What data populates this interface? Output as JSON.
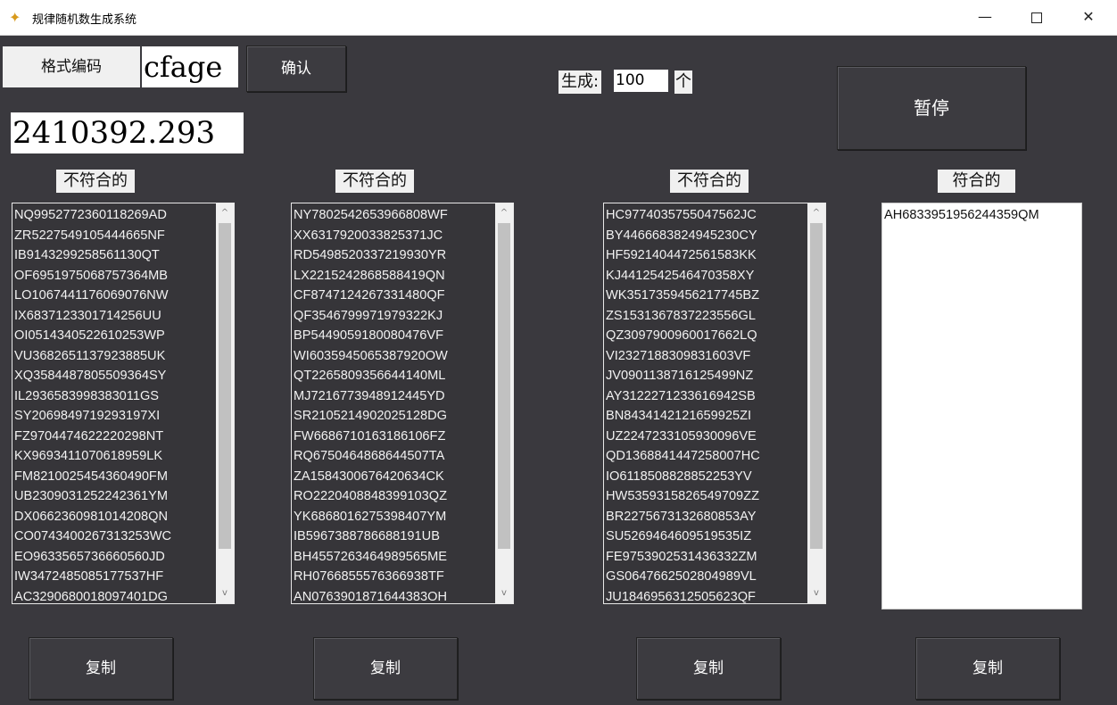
{
  "window": {
    "title": "规律随机数生成系统",
    "controls": {
      "minimize": "—",
      "close": "✕"
    }
  },
  "format": {
    "label": "格式编码",
    "value": "cfage",
    "confirm_label": "确认"
  },
  "generate": {
    "label": "生成:",
    "count": "100",
    "unit": "个",
    "pause_label": "暂停"
  },
  "number_display": "2410392.293",
  "columns": [
    {
      "label": "不符合的",
      "items": [
        "NQ9952772360118269AD",
        "ZR5227549105444665NF",
        "IB9143299258561130QT",
        "OF6951975068757364MB",
        "LO1067441176069076NW",
        "IX6837123301714256UU",
        "OI0514340522610253WP",
        "VU3682651137923885UK",
        "XQ3584487805509364SY",
        "IL2936583998383011GS",
        "SY2069849719293197XI",
        "FZ9704474622220298NT",
        "KX9693411070618959LK",
        "FM8210025454360490FM",
        "UB2309031252242361YM",
        "DX0662360981014208QN",
        "CO0743400267313253WC",
        "EO9633565736660560JD",
        "IW3472485085177537HF",
        "AC3290680018097401DG"
      ],
      "scroll": {
        "up": "^",
        "down": "v",
        "position": 0.0
      },
      "copy_label": "复制"
    },
    {
      "label": "不符合的",
      "items": [
        "NY7802542653966808WF",
        "XX6317920033825371JC",
        "RD5498520337219930YR",
        "LX2215242868588419QN",
        "CF8747124267331480QF",
        "QF3546799971979322KJ",
        "BP5449059180080476VF",
        "WI6035945065387920OW",
        "QT2265809356644140ML",
        "MJ7216773948912445YD",
        "SR2105214902025128DG",
        "FW6686710163186106FZ",
        "RQ6750464868644507TA",
        "ZA1584300676420634CK",
        "RO2220408848399103QZ",
        "YK6868016275398407YM",
        "IB5967388786688191UB",
        "BH4557263464989565ME",
        "RH0766855576366938TF",
        "AN0763901871644383OH"
      ],
      "scroll": {
        "up": "^",
        "down": "v",
        "position": 0.0
      },
      "copy_label": "复制"
    },
    {
      "label": "不符合的",
      "items": [
        "HC9774035755047562JC",
        "BY4466683824945230CY",
        "HF5921404472561583KK",
        "KJ4412542546470358XY",
        "WK3517359456217745BZ",
        "ZS1531367837223556GL",
        "QZ3097900960017662LQ",
        "VI2327188309831603VF",
        "JV0901138716125499NZ",
        "AY3122271233616942SB",
        "BN8434142121659925ZI",
        "UZ2247233105930096VE",
        "QD1368841447258007HC",
        "IO6118508828852253YV",
        "HW5359315826549709ZZ",
        "BR2275673132680853AY",
        "SU5269464609519535IZ",
        "FE9753902531436332ZM",
        "GS0647662502804989VL",
        "JU1846956312505623QF"
      ],
      "scroll": {
        "up": "^",
        "down": "v",
        "position": 0.0
      },
      "copy_label": "复制"
    },
    {
      "label": "符合的",
      "items": [
        "AH6833951956244359QM"
      ],
      "copy_label": "复制"
    }
  ]
}
